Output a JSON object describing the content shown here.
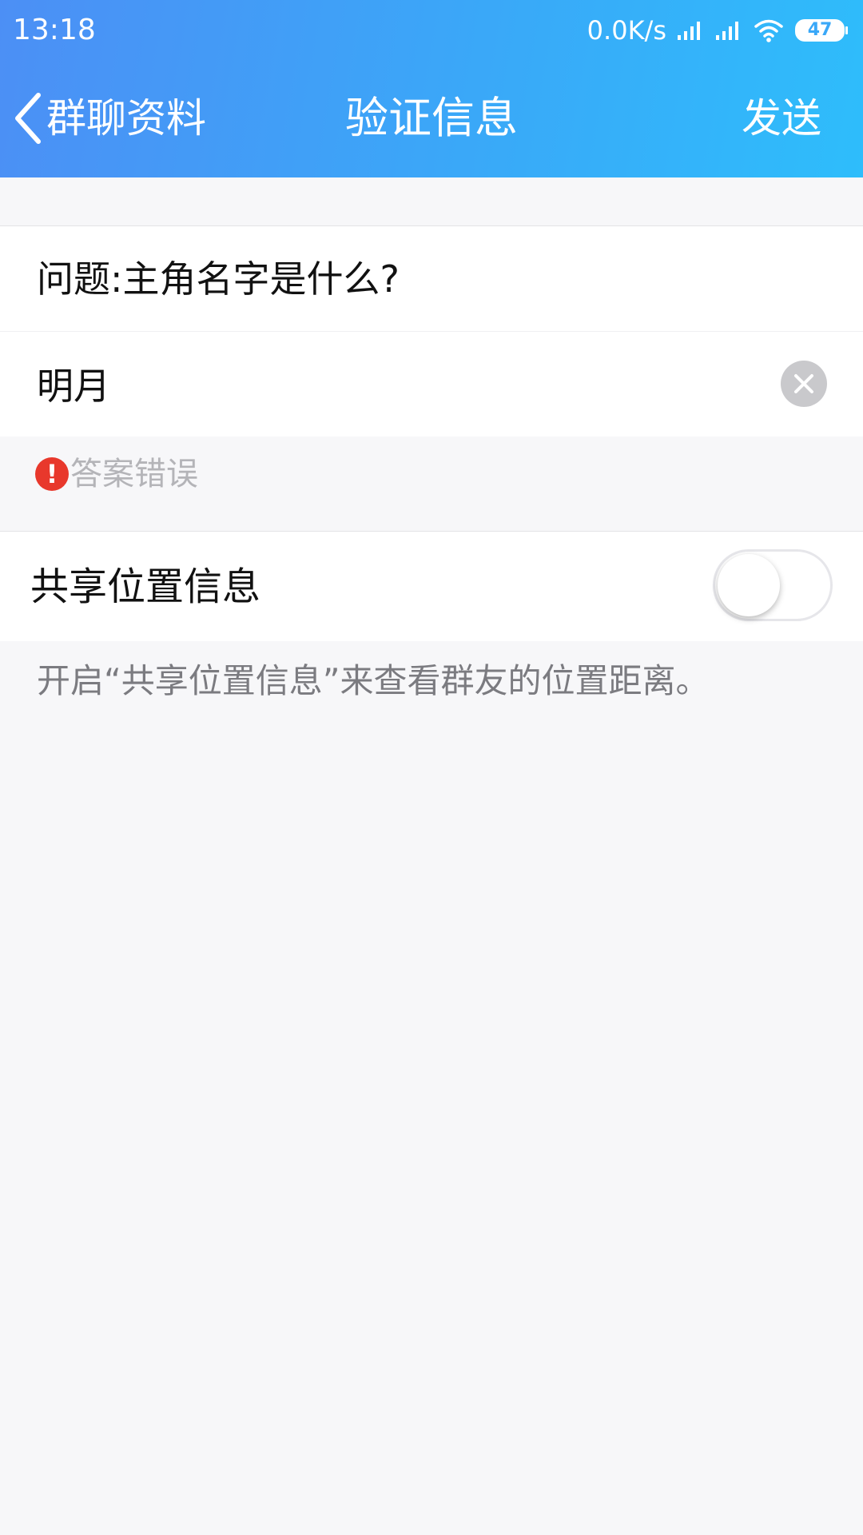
{
  "status_bar": {
    "time": "13:18",
    "net_speed": "0.0K/s",
    "battery_level": "47"
  },
  "nav": {
    "back_label": "群聊资料",
    "title": "验证信息",
    "send_label": "发送"
  },
  "form": {
    "question": "问题:主角名字是什么?",
    "answer_value": "明月",
    "error_text": "答案错误"
  },
  "location_share": {
    "label": "共享位置信息",
    "enabled": false,
    "hint": "开启“共享位置信息”来查看群友的位置距离。"
  },
  "colors": {
    "header_gradient_start": "#4c8ff5",
    "header_gradient_end": "#2ebdfb",
    "error_red": "#e8382c",
    "page_background": "#f7f7f9"
  },
  "icons": {
    "back": "chevron-left-icon",
    "clear": "close-icon",
    "error": "exclamation-icon",
    "signal": "signal-icon",
    "wifi": "wifi-icon",
    "battery": "battery-icon"
  }
}
